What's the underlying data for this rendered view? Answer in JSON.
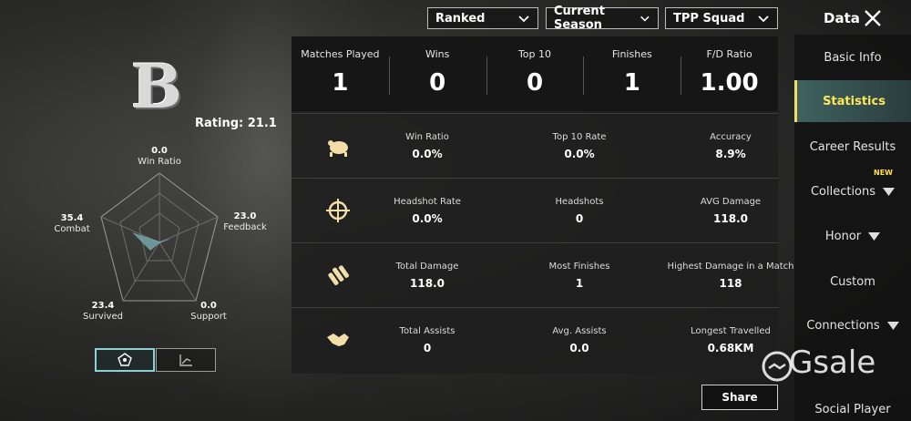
{
  "filters": {
    "mode": "Ranked",
    "season": "Current Season",
    "squad": "TPP Squad"
  },
  "header": {
    "title": "Data"
  },
  "profile": {
    "grade": "B",
    "rating": "Rating: 21.1",
    "radar": {
      "win_ratio": {
        "value": "0.0",
        "label": "Win Ratio"
      },
      "feedback": {
        "value": "23.0",
        "label": "Feedback"
      },
      "support": {
        "value": "0.0",
        "label": "Support"
      },
      "survived": {
        "value": "23.4",
        "label": "Survived"
      },
      "combat": {
        "value": "35.4",
        "label": "Combat"
      }
    }
  },
  "summary": [
    {
      "label": "Matches Played",
      "value": "1"
    },
    {
      "label": "Wins",
      "value": "0"
    },
    {
      "label": "Top 10",
      "value": "0"
    },
    {
      "label": "Finishes",
      "value": "1"
    },
    {
      "label": "F/D Ratio",
      "value": "1.00"
    }
  ],
  "rows": [
    {
      "icon": "chicken-icon",
      "cells": [
        {
          "label": "Win Ratio",
          "value": "0.0%"
        },
        {
          "label": "Top 10 Rate",
          "value": "0.0%"
        },
        {
          "label": "Accuracy",
          "value": "8.9%"
        }
      ]
    },
    {
      "icon": "crosshair-icon",
      "cells": [
        {
          "label": "Headshot Rate",
          "value": "0.0%"
        },
        {
          "label": "Headshots",
          "value": "0"
        },
        {
          "label": "AVG Damage",
          "value": "118.0"
        }
      ]
    },
    {
      "icon": "bullets-icon",
      "cells": [
        {
          "label": "Total Damage",
          "value": "118.0"
        },
        {
          "label": "Most Finishes",
          "value": "1"
        },
        {
          "label": "Highest Damage in a Match",
          "value": "118"
        }
      ]
    },
    {
      "icon": "handshake-icon",
      "cells": [
        {
          "label": "Total Assists",
          "value": "0"
        },
        {
          "label": "Avg. Assists",
          "value": "0.0"
        },
        {
          "label": "Longest Travelled",
          "value": "0.68KM"
        }
      ]
    }
  ],
  "share_label": "Share",
  "nav": {
    "items": [
      {
        "label": "Basic Info"
      },
      {
        "label": "Statistics"
      },
      {
        "label": "Career Results"
      },
      {
        "label": "Collections",
        "badge": "NEW"
      },
      {
        "label": "Honor"
      },
      {
        "label": "Custom"
      },
      {
        "label": "Connections"
      },
      {
        "label": "Social Player"
      }
    ]
  },
  "watermark": "Gsale",
  "colors": {
    "active_nav": "#ffe75a",
    "accent": "#8fd0d2"
  }
}
